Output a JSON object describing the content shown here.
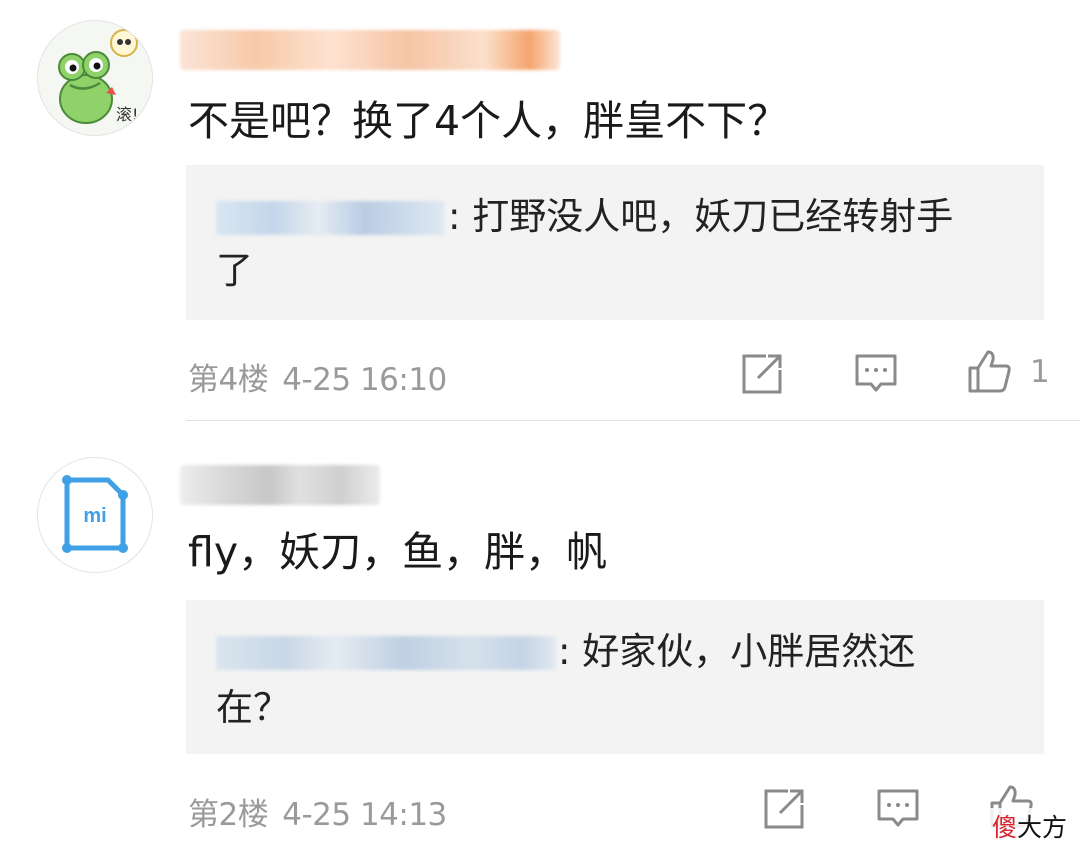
{
  "comments": [
    {
      "text": "不是吧？换了4个人，胖皇不下？",
      "avatar_badge": "滚!",
      "reply": {
        "line1": ": 打野没人吧，妖刀已经转射手",
        "line2": "了"
      },
      "floor": "第4楼",
      "time": "4-25 16:10",
      "like_count": "1"
    },
    {
      "text": "fly，妖刀，鱼，胖，帆",
      "avatar_logo": "mi",
      "reply": {
        "line1": ": 好家伙，小胖居然还",
        "line2": "在？"
      },
      "floor": "第2楼",
      "time": "4-25 14:13",
      "like_count": ""
    }
  ],
  "icons": {
    "share": "share-icon",
    "reply": "reply-icon",
    "like": "thumbs-up-icon"
  },
  "colors": {
    "reply_bg": "#f3f3f3",
    "meta_text": "#9a9a9a",
    "mi_logo": "#3fa0e6"
  },
  "watermark": {
    "part1": "傻",
    "part2": "大方"
  }
}
